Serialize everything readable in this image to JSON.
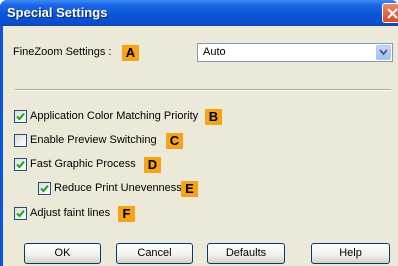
{
  "dialog": {
    "title": "Special Settings"
  },
  "finezoom": {
    "label": "FineZoom Settings :",
    "badge": "A",
    "selected": "Auto"
  },
  "options": [
    {
      "label": "Application Color Matching Priority",
      "badge": "B",
      "checked": true
    },
    {
      "label": "Enable Preview Switching",
      "badge": "C",
      "checked": false
    },
    {
      "label": "Fast Graphic Process",
      "badge": "D",
      "checked": true
    },
    {
      "label": "Reduce Print Unevenness",
      "badge": "E",
      "checked": true
    },
    {
      "label": "Adjust faint lines",
      "badge": "F",
      "checked": true
    }
  ],
  "buttons": {
    "ok": "OK",
    "cancel": "Cancel",
    "defaults": "Defaults",
    "help": "Help"
  },
  "colors": {
    "badge": "#f5a31a",
    "titlebar": "#0a55d9",
    "dialog_bg": "#ece9d8",
    "checkmark": "#21a121"
  }
}
